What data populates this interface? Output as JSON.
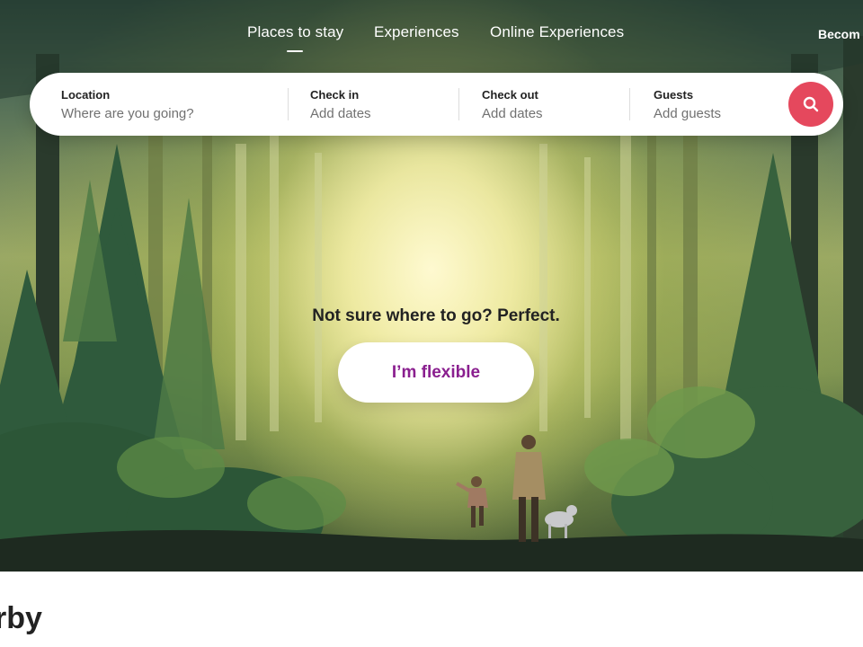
{
  "nav": {
    "tabs": [
      {
        "label": "Places to stay",
        "active": true
      },
      {
        "label": "Experiences",
        "active": false
      },
      {
        "label": "Online Experiences",
        "active": false
      }
    ],
    "host_link": "Becom"
  },
  "search": {
    "fields": [
      {
        "label": "Location",
        "value": "Where are you going?"
      },
      {
        "label": "Check in",
        "value": "Add dates"
      },
      {
        "label": "Check out",
        "value": "Add dates"
      },
      {
        "label": "Guests",
        "value": "Add guests"
      }
    ],
    "button_icon": "search-icon"
  },
  "hero": {
    "tagline": "Not sure where to go? Perfect.",
    "cta_label": "I’m flexible"
  },
  "section": {
    "title_fragment": "rby"
  },
  "colors": {
    "accent": "#e5485d",
    "cta_text": "#8a1f8f",
    "text_primary": "#222222",
    "text_muted": "#717171"
  }
}
